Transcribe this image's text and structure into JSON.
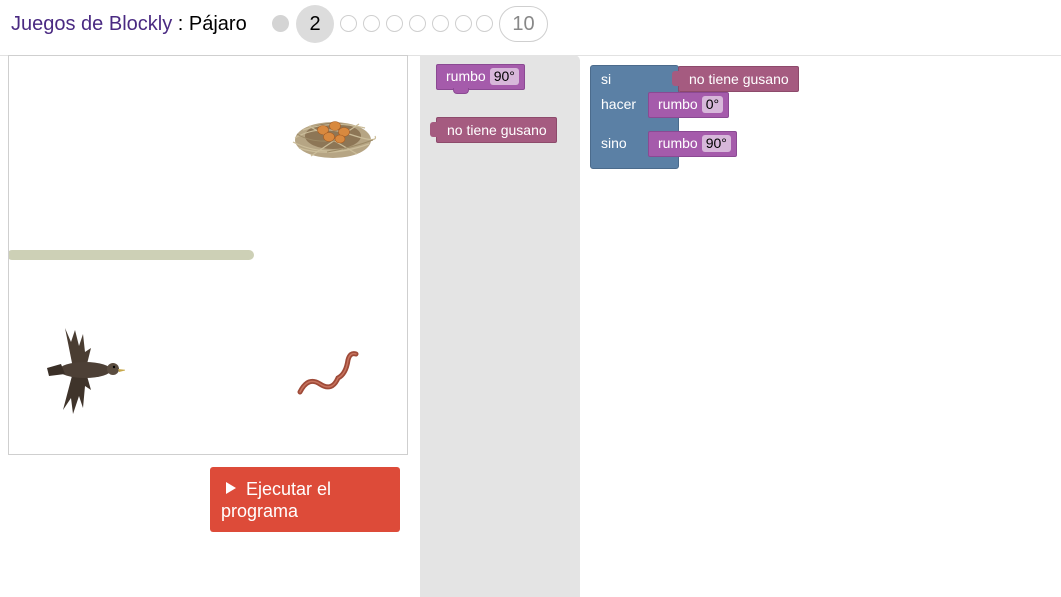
{
  "header": {
    "app_title": "Juegos de Blockly",
    "separator": " : ",
    "game_name": "Pájaro",
    "current_level": "2",
    "last_level": "10"
  },
  "run_button": {
    "label": "Ejecutar el programa"
  },
  "toolbox": {
    "heading_block": {
      "keyword": "rumbo",
      "value": "90°"
    },
    "condition_block": {
      "label": "no tiene gusano"
    }
  },
  "workspace": {
    "if_block": {
      "if_label": "si",
      "do_label": "hacer",
      "else_label": "sino",
      "condition": "no tiene gusano",
      "do_block": {
        "keyword": "rumbo",
        "value": "0°"
      },
      "else_block": {
        "keyword": "rumbo",
        "value": "90°"
      }
    }
  },
  "colors": {
    "accent_title": "#4a2a82",
    "run_button": "#dd4b39",
    "heading_block": "#a55bab",
    "condition_block": "#a55b80",
    "logic_block": "#5b80a5",
    "wall": "#cdd0b6"
  },
  "icons": [
    "nest-icon",
    "bird-icon",
    "worm-icon",
    "play-icon"
  ]
}
